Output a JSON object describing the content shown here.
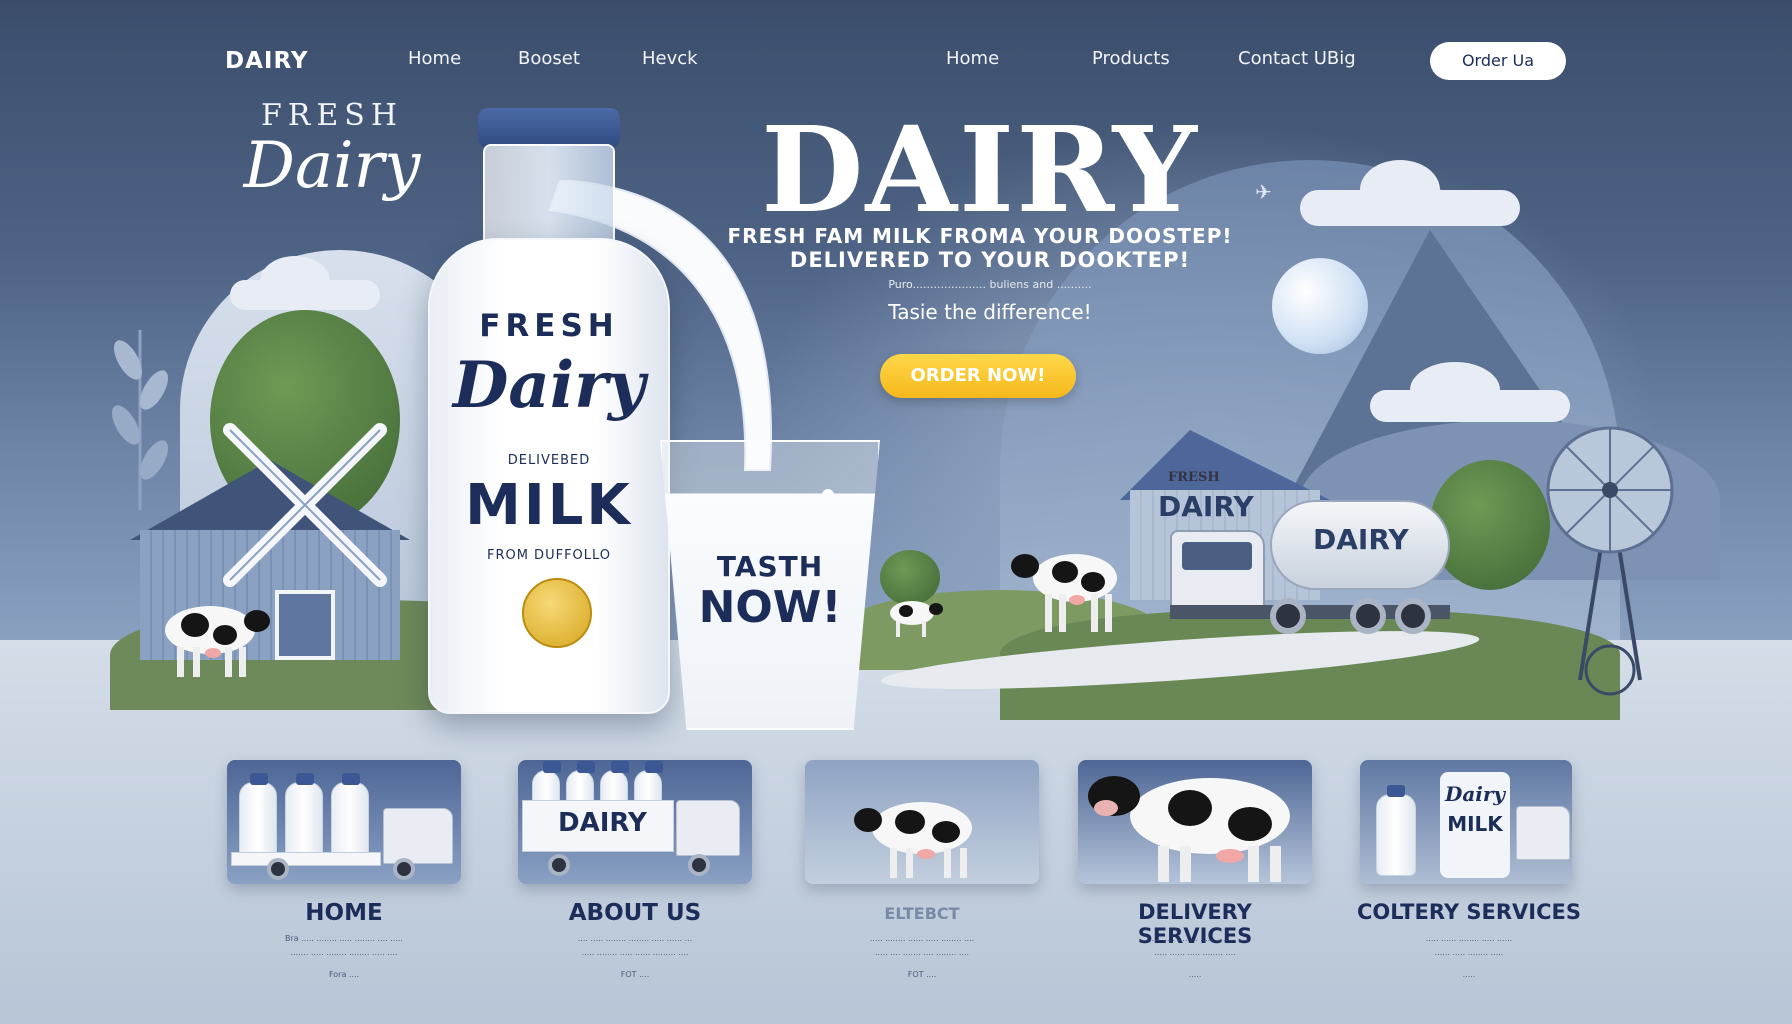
{
  "nav": {
    "logo": "DAIRY",
    "links": [
      "Home",
      "Booset",
      "Hevck",
      "Home",
      "Products",
      "Contact UBig"
    ],
    "order_button": "Order Ua"
  },
  "brand": {
    "fresh": "FRESH",
    "dairy": "Dairy"
  },
  "hero": {
    "title": "DAIRY",
    "line1": "FRESH FAM MILK FROMA YOUR DOOSTEP!",
    "line2": "DELIVERED TO YOUR DOOKTEP!",
    "line3": "Puro..................... buliens and ..........",
    "line4": "Tasie the difference!",
    "cta": "ORDER NOW!"
  },
  "bottle": {
    "fresh": "FRESH",
    "dairy": "Dairy",
    "delivered": "DELIVEBED",
    "milk": "MILK",
    "from": "FROM DUFFOLLO"
  },
  "glass": {
    "line1": "TASTH",
    "line2": "NOW!"
  },
  "scene": {
    "barn_sign_small": "FRESH",
    "barn_sign_big": "DAIRY",
    "truck_label": "DAIRY"
  },
  "cards": [
    {
      "title": "HOME",
      "text1": "Bra ..... ........ ..... ........ .... .....",
      "text2": "....... ..... ........ ........ ..... ....",
      "small": "Fora ...."
    },
    {
      "title": "ABOUT US",
      "text1": ".... ..... ........ ........ ..... ...... ...",
      "text2": "..... ........ ..... ...... ......... ....",
      "small": "FOT ...."
    },
    {
      "title": "ELTEBCT",
      "text1": "..... ........ ...... ..... ........ ....",
      "text2": "..... .... ....... .... ........ ....",
      "small": "FOT ...."
    },
    {
      "title": "DELIVERY SERVICES",
      "text1": "....... ..... ........ ..... ........ ....",
      "text2": "..... ...... ..... ........ ....",
      "small": "....."
    },
    {
      "title": "COLTERY SERVICES",
      "text1": "..... ...... ........ ..... ......",
      "text2": "...... ..... ........ .....",
      "small": "....."
    }
  ],
  "card_labels": {
    "about_truck": "DAIRY",
    "colt_dairy": "Dairy",
    "colt_milk": "MILK"
  },
  "colors": {
    "navy": "#1d2d5a",
    "sky": "#4e6385",
    "cta_yellow": "#f5b81b"
  }
}
